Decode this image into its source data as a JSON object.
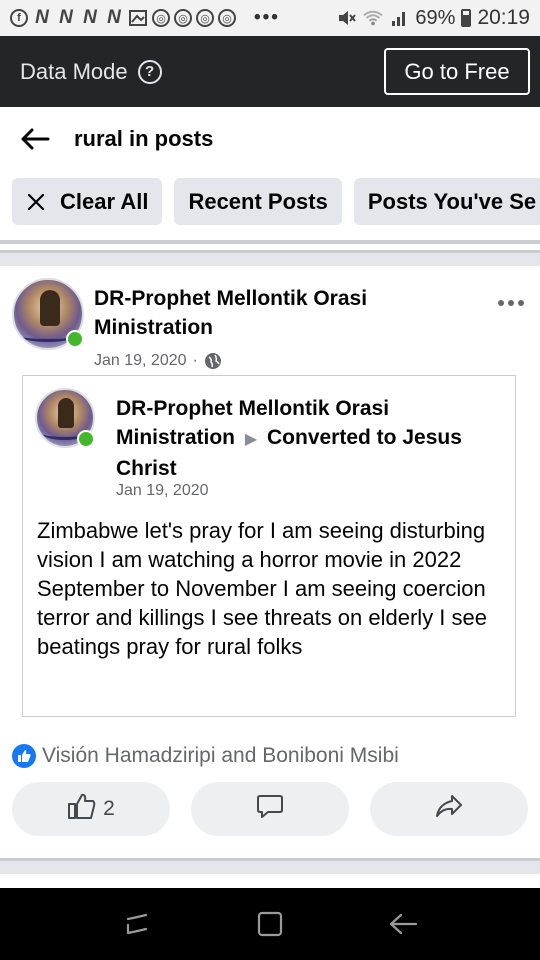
{
  "status_bar": {
    "battery": "69%",
    "time": "20:19"
  },
  "data_bar": {
    "title": "Data Mode",
    "help_glyph": "?",
    "go_free_label": "Go to Free"
  },
  "search": {
    "query": "rural in posts"
  },
  "chips": {
    "clear_all": "Clear All",
    "recent_posts": "Recent Posts",
    "posts_seen": "Posts You've Se"
  },
  "post": {
    "author": "DR-Prophet Mellontik Orasi Ministration",
    "date": "Jan 19, 2020",
    "meta_separator": "·",
    "shared": {
      "author": "DR-Prophet Mellontik Orasi Ministration",
      "arrow": "▶",
      "target": "Converted to Jesus Christ",
      "date": "Jan 19, 2020",
      "text": "Zimbabwe  let's pray  for I am seeing disturbing vision I am watching  a  horror movie in 2022 September  to November  I am seeing  coercion  terror and killings  I see threats  on elderly  I see beatings pray for rural  folks"
    },
    "reactions_text": "Visión Hamadziripi and Boniboni Msibi",
    "like_count": "2"
  },
  "icons": {
    "back": "arrow-left",
    "clear": "x",
    "more": "ellipsis",
    "globe": "globe",
    "like": "thumbs-up",
    "comment": "speech-bubble",
    "share": "share-arrow",
    "nav_recent": "recent-apps",
    "nav_home": "home-square",
    "nav_back": "back-arrow"
  },
  "colors": {
    "brand_blue": "#1877f2",
    "online_green": "#42b72a",
    "dark_bar": "#242526"
  }
}
